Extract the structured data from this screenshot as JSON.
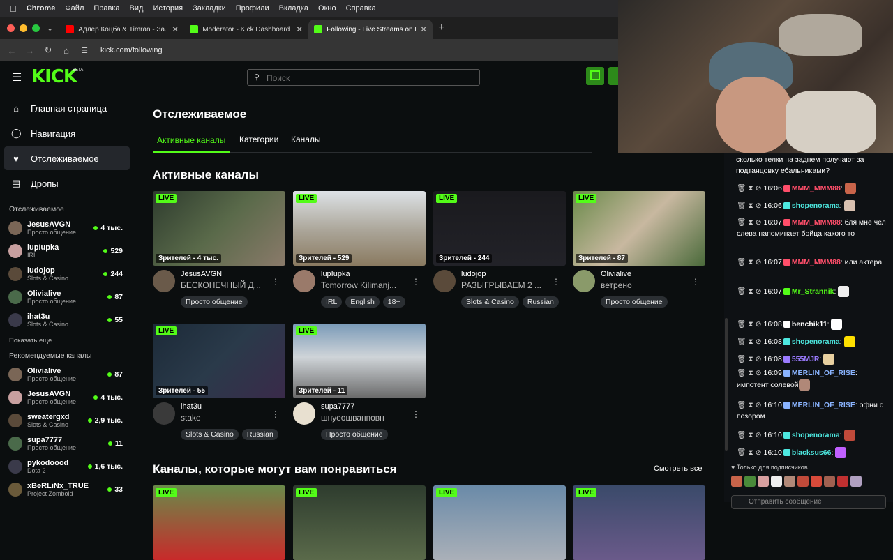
{
  "menubar": {
    "app": "Chrome",
    "items": [
      "Файл",
      "Правка",
      "Вид",
      "История",
      "Закладки",
      "Профили",
      "Вкладка",
      "Окно",
      "Справка"
    ]
  },
  "tabs": [
    {
      "title": "Адлер Коцба & Timran - За..."
    },
    {
      "title": "Moderator - Kick Dashboard"
    },
    {
      "title": "Following - Live Streams on K..."
    }
  ],
  "address": {
    "url": "kick.com/following"
  },
  "header": {
    "logo": "KICK",
    "beta": "BETA",
    "search_placeholder": "Поиск"
  },
  "nav": [
    {
      "label": "Главная страница",
      "icon": "home-icon"
    },
    {
      "label": "Навигация",
      "icon": "compass-icon"
    },
    {
      "label": "Отслеживаемое",
      "icon": "heart-icon"
    },
    {
      "label": "Дропы",
      "icon": "gift-icon"
    }
  ],
  "sidebar": {
    "following_title": "Отслеживаемое",
    "following": [
      {
        "name": "JesusAVGN",
        "cat": "Просто общение",
        "viewers": "4 тыс."
      },
      {
        "name": "lupIupka",
        "cat": "IRL",
        "viewers": "529"
      },
      {
        "name": "ludojop",
        "cat": "Slots & Casino",
        "viewers": "244"
      },
      {
        "name": "Olivialive",
        "cat": "Просто общение",
        "viewers": "87"
      },
      {
        "name": "ihat3u",
        "cat": "Slots & Casino",
        "viewers": "55"
      }
    ],
    "show_more": "Показать еще",
    "recommended_title": "Рекомендуемые каналы",
    "recommended": [
      {
        "name": "Olivialive",
        "cat": "Просто общение",
        "viewers": "87"
      },
      {
        "name": "JesusAVGN",
        "cat": "Просто общение",
        "viewers": "4 тыс."
      },
      {
        "name": "sweatergxd",
        "cat": "Slots & Casino",
        "viewers": "2,9 тыс."
      },
      {
        "name": "supa7777",
        "cat": "Просто общение",
        "viewers": "11"
      },
      {
        "name": "pykodoood",
        "cat": "Dota 2",
        "viewers": "1,6 тыс."
      },
      {
        "name": "xBeRLiNx_TRUE",
        "cat": "Project Zomboid",
        "viewers": "33"
      }
    ]
  },
  "main": {
    "title": "Отслеживаемое",
    "tabs": [
      "Активные каналы",
      "Категории",
      "Каналы"
    ],
    "section_title": "Активные каналы",
    "cards": [
      {
        "live": "LIVE",
        "viewers": "Зрителей - 4 тыс.",
        "name": "JesusAVGN",
        "title": "БЕСКОНЕЧНЫЙ Д...",
        "tags": [
          "Просто общение"
        ]
      },
      {
        "live": "LIVE",
        "viewers": "Зрителей - 529",
        "name": "lupIupka",
        "title": "Tomorrow Kilimanj...",
        "tags": [
          "IRL",
          "English",
          "18+"
        ]
      },
      {
        "live": "LIVE",
        "viewers": "Зрителей - 244",
        "name": "ludojop",
        "title": "РАЗЫГРЫВАЕМ 2 ...",
        "tags": [
          "Slots & Casino",
          "Russian"
        ]
      },
      {
        "live": "LIVE",
        "viewers": "Зрителей - 87",
        "name": "Olivialive",
        "title": "ветрено",
        "tags": [
          "Просто общение"
        ]
      },
      {
        "live": "LIVE",
        "viewers": "Зрителей - 55",
        "name": "ihat3u",
        "title": "stake",
        "tags": [
          "Slots & Casino",
          "Russian"
        ]
      },
      {
        "live": "LIVE",
        "viewers": "Зрителей - 11",
        "name": "supa7777",
        "title": "шнуеошванповн",
        "tags": [
          "Просто общение"
        ]
      }
    ],
    "recommend_title": "Каналы, которые могут вам понравиться",
    "see_all": "Смотреть все",
    "bottom_live": [
      "LIVE",
      "LIVE",
      "LIVE",
      "LIVE"
    ]
  },
  "chat": {
    "top_text": "сколько телки на заднем получают за подтанцовку ебальниками?",
    "messages": [
      {
        "time": "16:06",
        "user": "MMM_MMM88",
        "text": "",
        "color": "#ff4e6a"
      },
      {
        "time": "16:06",
        "user": "shopenorama",
        "text": "",
        "color": "#4de8e0"
      },
      {
        "time": "16:07",
        "user": "MMM_MMM88",
        "text": "бля мне чел слева напоминает бойца какого то",
        "color": "#ff4e6a"
      },
      {
        "time": "16:07",
        "user": "MMM_MMM88",
        "text": "или актера",
        "color": "#ff4e6a"
      },
      {
        "time": "16:07",
        "user": "Mr_Strannik",
        "text": "",
        "color": "#53fc18"
      },
      {
        "time": "16:08",
        "user": "benchik11",
        "text": "",
        "color": "#ffffff"
      },
      {
        "time": "16:08",
        "user": "shopenorama",
        "text": "",
        "color": "#4de8e0"
      },
      {
        "time": "16:08",
        "user": "555MJR",
        "text": "",
        "color": "#9b7bff"
      },
      {
        "time": "16:09",
        "user": "MERLIN_OF_RISE",
        "text": "импотент солевой",
        "color": "#8ab4ff"
      },
      {
        "time": "16:10",
        "user": "MERLIN_OF_RISE",
        "text": "офни с позором",
        "color": "#8ab4ff"
      },
      {
        "time": "16:10",
        "user": "shopenorama",
        "text": "",
        "color": "#4de8e0"
      },
      {
        "time": "16:10",
        "user": "blacksus66",
        "text": "",
        "color": "#4de8e0"
      }
    ],
    "subs_only": "Только для подписчиков",
    "input_placeholder": "Отправить сообщение"
  }
}
